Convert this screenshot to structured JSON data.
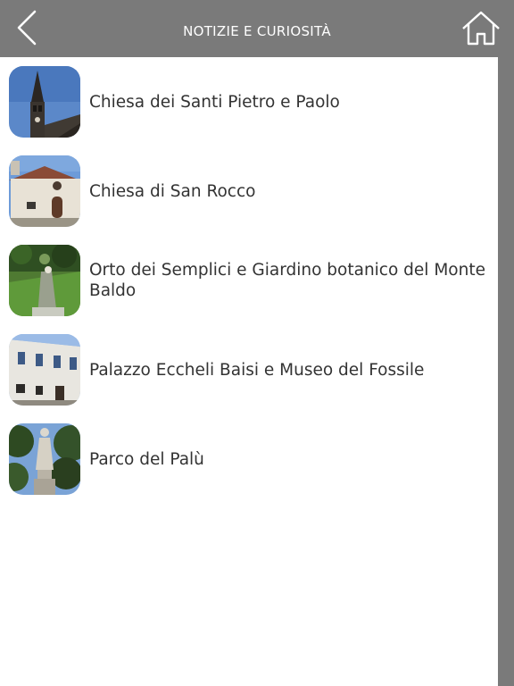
{
  "header": {
    "title": "NOTIZIE E CURIOSITÀ"
  },
  "list": {
    "items": [
      {
        "label": "Chiesa dei Santi Pietro e Paolo"
      },
      {
        "label": "Chiesa di San Rocco"
      },
      {
        "label": "Orto dei Semplici e Giardino botanico del Monte Baldo"
      },
      {
        "label": "Palazzo Eccheli Baisi e Museo del Fossile"
      },
      {
        "label": "Parco del Palù"
      }
    ]
  }
}
